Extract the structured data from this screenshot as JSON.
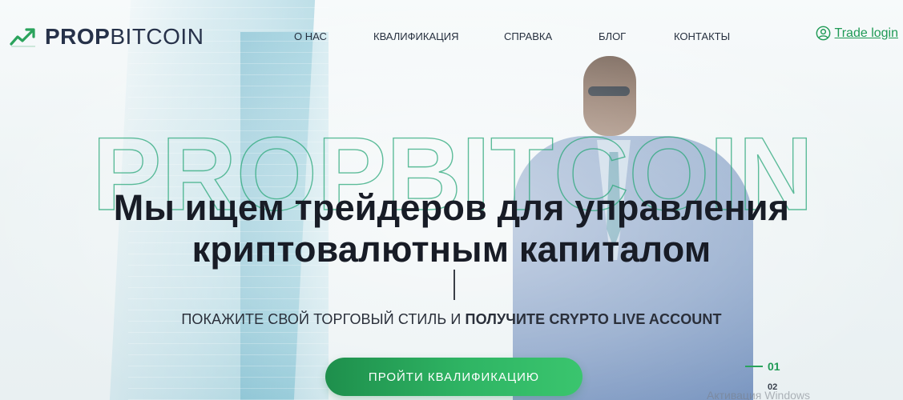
{
  "header": {
    "logo": {
      "bold": "PROP",
      "light": "BITCOIN"
    },
    "nav": [
      {
        "label": "О НАС"
      },
      {
        "label": "КВАЛИФИКАЦИЯ"
      },
      {
        "label": "СПРАВКА"
      },
      {
        "label": "БЛОГ"
      },
      {
        "label": "КОНТАКТЫ"
      }
    ],
    "trade_login": "Trade login"
  },
  "hero": {
    "watermark": "PROPBITCOIN",
    "headline_line1": "Мы ищем трейдеров для управления",
    "headline_line2": "криптовалютным капиталом",
    "subline_regular": "ПОКАЖИТЕ СВОЙ ТОРГОВЫЙ СТИЛЬ И",
    "subline_bold": "ПОЛУЧИТЕ CRYPTO LIVE ACCOUNT",
    "cta_label": "ПРОЙТИ КВАЛИФИКАЦИЮ"
  },
  "slider": {
    "active": "01",
    "next": "02"
  },
  "os_overlay": {
    "activation_text": "Активация Windows"
  },
  "colors": {
    "brand_green": "#1f9a55",
    "text_dark": "#181c26"
  }
}
